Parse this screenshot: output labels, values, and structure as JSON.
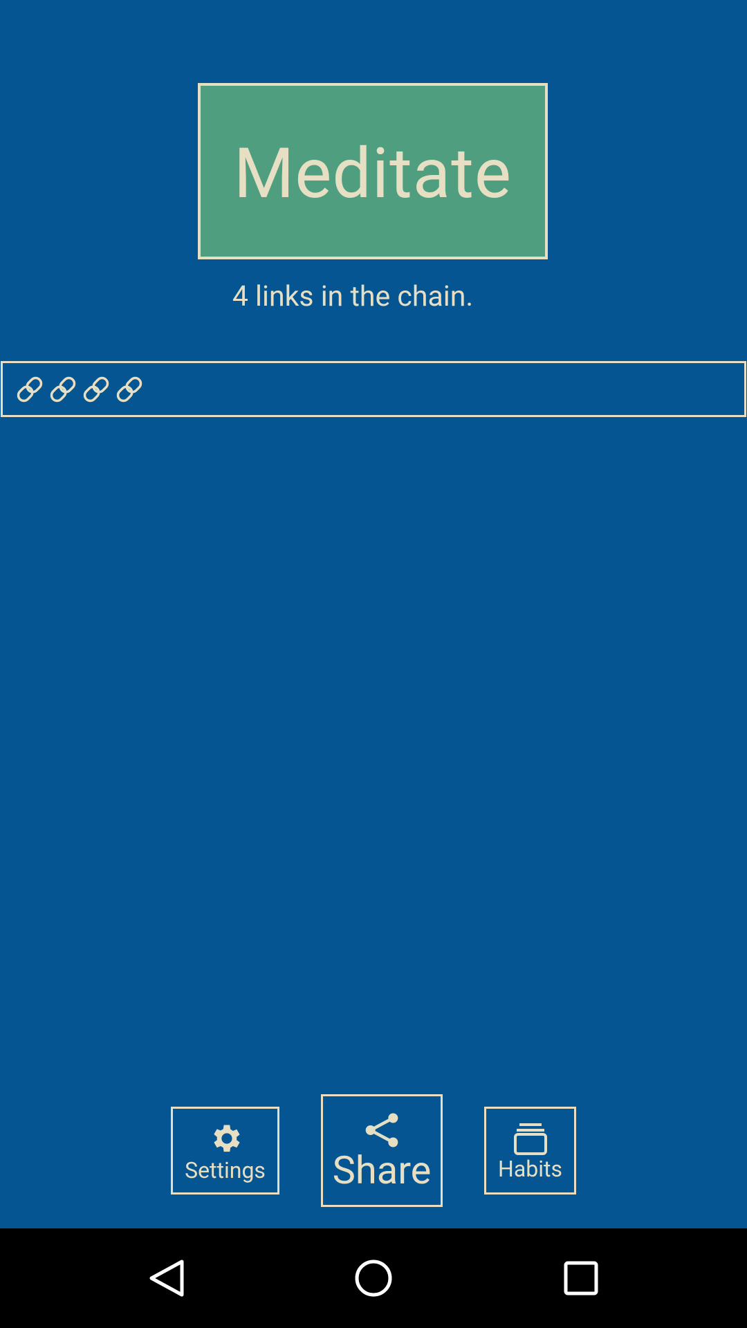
{
  "habit": {
    "name": "Meditate"
  },
  "chain": {
    "summary": "4 links in the chain.",
    "link_count": 4,
    "link_icon": "chain-link-icon"
  },
  "toolbar": {
    "settings_label": "Settings",
    "share_label": "Share",
    "habits_label": "Habits"
  },
  "nav": {
    "back_icon": "back-triangle-icon",
    "home_icon": "home-circle-icon",
    "recents_icon": "recents-square-icon"
  },
  "colors": {
    "background": "#045591",
    "accent": "#4f9e7f",
    "foreground": "#e6dfc3",
    "navbar": "#000000"
  }
}
